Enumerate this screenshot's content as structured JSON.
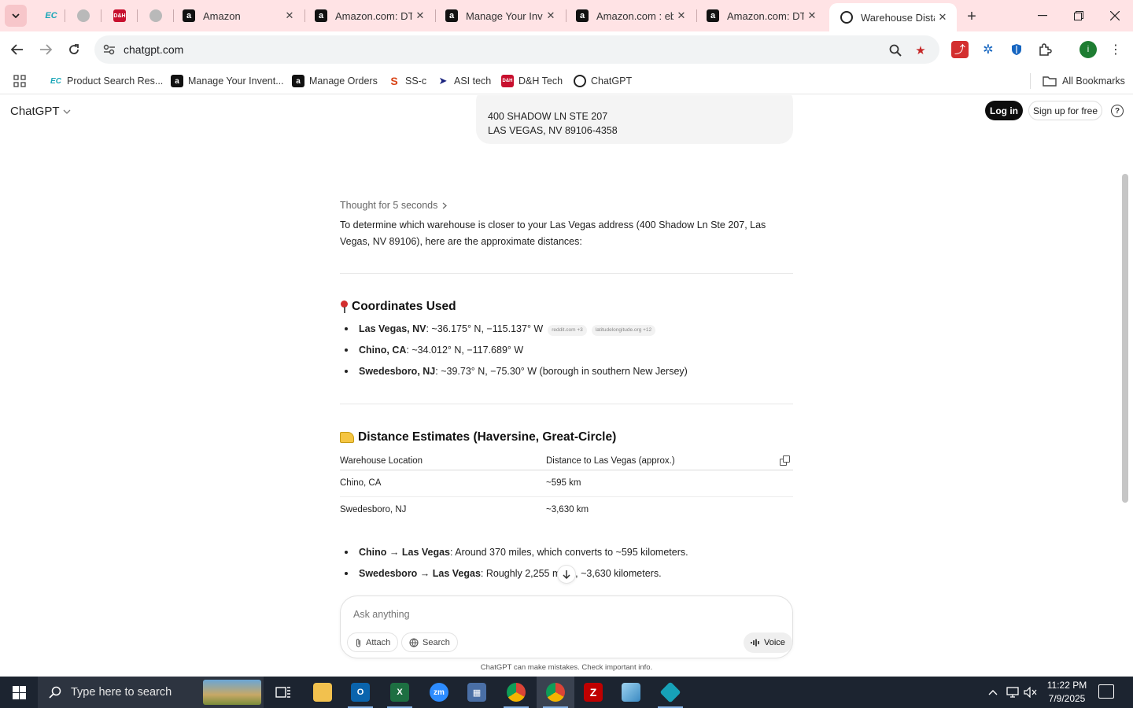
{
  "browser": {
    "tabs": [
      {
        "title": "",
        "favicon": "ec-icon"
      },
      {
        "title": "",
        "favicon": "globe-icon"
      },
      {
        "title": "",
        "favicon": "dh-tech-icon"
      },
      {
        "title": "",
        "favicon": "globe-icon"
      },
      {
        "title": "Amazon",
        "favicon": "amazon-icon"
      },
      {
        "title": "Amazon.com: DTE",
        "favicon": "amazon-smile-icon"
      },
      {
        "title": "Manage Your Inve",
        "favicon": "amazon-icon"
      },
      {
        "title": "Amazon.com : eb",
        "favicon": "amazon-smile-icon"
      },
      {
        "title": "Amazon.com: DTE",
        "favicon": "amazon-smile-icon"
      },
      {
        "title": "Warehouse Distan",
        "favicon": "chatgpt-icon",
        "active": true
      }
    ],
    "url": "chatgpt.com",
    "profile_initial": "i",
    "bookmarks": [
      {
        "label": "Product Search Res..."
      },
      {
        "label": "Manage Your Invent..."
      },
      {
        "label": "Manage Orders"
      },
      {
        "label": "SS-c"
      },
      {
        "label": "ASI tech"
      },
      {
        "label": "D&H Tech"
      },
      {
        "label": "ChatGPT"
      }
    ],
    "all_bookmarks": "All Bookmarks",
    "accent_color": "#ffe3e5"
  },
  "chatgpt": {
    "brand": "ChatGPT",
    "login": "Log in",
    "signup": "Sign up for free",
    "help": "?",
    "user_message": {
      "line1": "400 SHADOW LN STE 207",
      "line2": "LAS VEGAS, NV 89106-4358"
    },
    "thought": "Thought for 5 seconds",
    "intro": "To determine which warehouse is closer to your Las Vegas address (400 Shadow Ln Ste 207, Las Vegas, NV 89106), here are the approximate distances:",
    "coords_heading": "Coordinates Used",
    "coords": [
      {
        "name": "Las Vegas, NV",
        "value": ": ~36.175° N, −115.137° W",
        "cite1": "reddit.com +3",
        "cite2": "latitudelongitude.org +12"
      },
      {
        "name": "Chino, CA",
        "value": ": ~34.012° N, −117.689° W"
      },
      {
        "name": "Swedesboro, NJ",
        "value": ": ~39.73° N, −75.30° W (borough in southern New Jersey)"
      }
    ],
    "dist_heading": "Distance Estimates (Haversine, Great-Circle)",
    "table": {
      "headers": [
        "Warehouse Location",
        "Distance to Las Vegas (approx.)"
      ],
      "rows": [
        [
          "Chino, CA",
          "~595 km"
        ],
        [
          "Swedesboro, NJ",
          "~3,630 km"
        ]
      ]
    },
    "summary": [
      {
        "name": "Chino → Las Vegas",
        "value": ": Around 370 miles, which converts to ~595 kilometers."
      },
      {
        "name": "Swedesboro → Las Vegas",
        "value": ": Roughly 2,255 miles, ~3,630 kilometers."
      }
    ],
    "composer": {
      "placeholder": "Ask anything",
      "attach": "Attach",
      "search": "Search",
      "voice": "Voice"
    },
    "disclaimer": "ChatGPT can make mistakes. Check important info."
  },
  "taskbar": {
    "search_placeholder": "Type here to search",
    "time": "11:22 PM",
    "date": "7/9/2025"
  }
}
